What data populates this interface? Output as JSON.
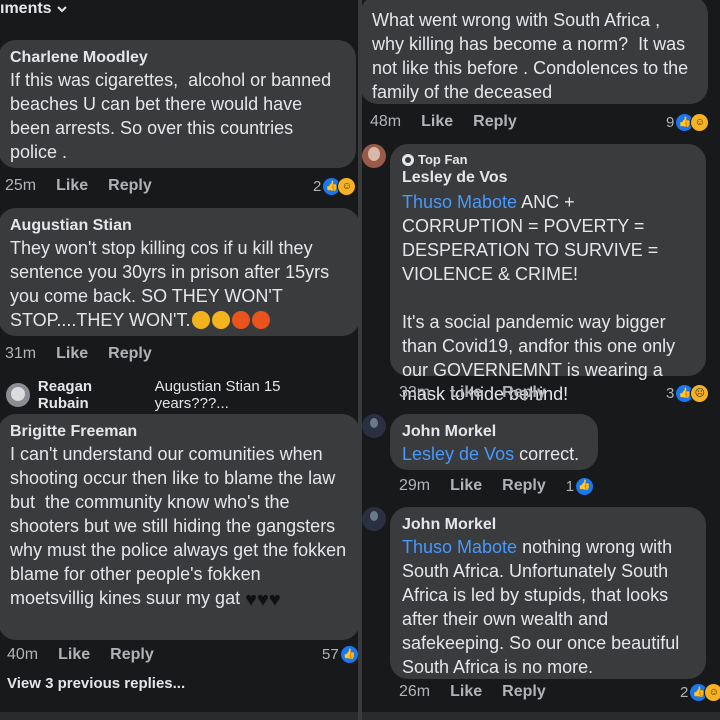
{
  "left": {
    "header_partial": "ıments",
    "comments": [
      {
        "name": "Charlene Moodley",
        "text": "If this was cigarettes,  alcohol or banned beaches U can bet there would have been arrests. So over this countries police .",
        "time": "25m",
        "like": "Like",
        "reply": "Reply",
        "count": "2"
      },
      {
        "name": "Augustian Stian",
        "text": "They won't stop killing cos if u kill they sentence you 30yrs in prison after 15yrs you come back. SO THEY WON'T STOP....THEY WON'T.",
        "time": "31m",
        "like": "Like",
        "reply": "Reply"
      },
      {
        "reply_preview_name": "Reagan Rubain",
        "reply_preview_text": "Augustian Stian 15 years???..."
      },
      {
        "name": "Brigitte Freeman",
        "text": "I can't understand our comunities when shooting occur then like to blame the law but  the community know who's the shooters but we still hiding the gangsters why must the police always get the fokken blame for other people's fokken moetsvillig kines suur my gat",
        "time": "40m",
        "like": "Like",
        "reply": "Reply",
        "count": "57"
      }
    ],
    "view_previous": "View 3 previous replies..."
  },
  "right": {
    "comments": [
      {
        "text": "What went wrong with South Africa , why killing has become a norm?  It was not like this before . Condolences to the family of the deceased",
        "time": "48m",
        "like": "Like",
        "reply": "Reply",
        "count": "9"
      },
      {
        "badge": "Top Fan",
        "name": "Lesley de Vos",
        "mention": "Thuso Mabote",
        "text": " ANC + CORRUPTION = POVERTY = DESPERATION TO SURVIVE = VIOLENCE & CRIME!\n\nIt's a social pandemic way bigger than Covid19, andfor this one only our GOVERNEMNT is wearing a mask to hide behind!",
        "time": "33m",
        "like": "Like",
        "reply": "Reply",
        "count": "3"
      },
      {
        "name": "John Morkel",
        "mention": "Lesley de Vos",
        "text": " correct.",
        "time": "29m",
        "like": "Like",
        "reply": "Reply",
        "count": "1"
      },
      {
        "name": "John Morkel",
        "mention": "Thuso Mabote",
        "text": " nothing wrong with South Africa. Unfortunately South Africa is led by stupids, that looks after their own wealth and safekeeping. So our once beautiful South Africa is no more.",
        "time": "26m",
        "like": "Like",
        "reply": "Reply",
        "count": "2"
      }
    ]
  },
  "icons": {
    "like": "like-reaction-icon",
    "haha": "haha-reaction-icon",
    "sad": "sad-reaction-icon",
    "chevron": "chevron-down-icon"
  }
}
